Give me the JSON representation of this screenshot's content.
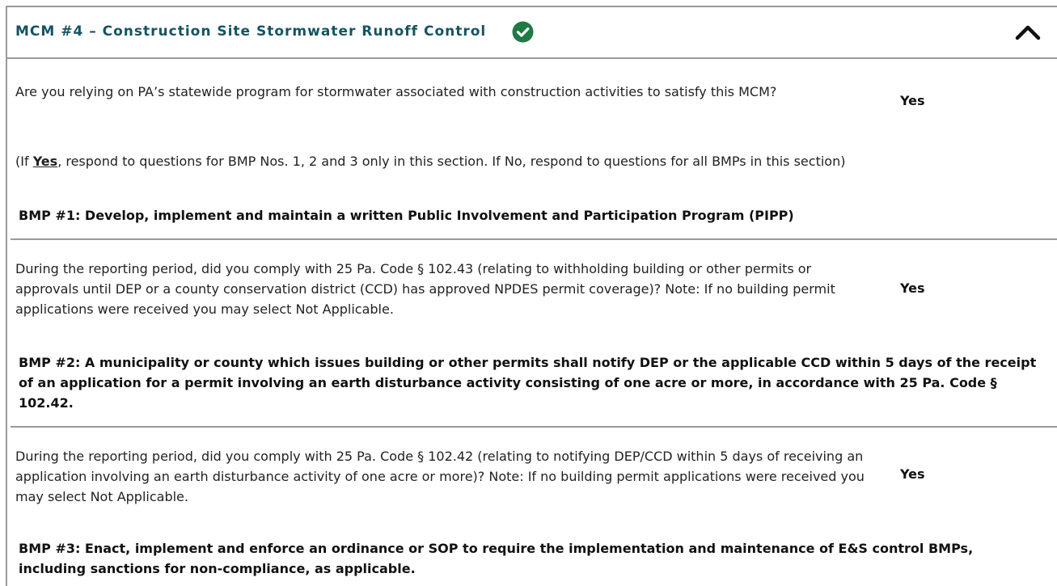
{
  "section": {
    "title": "MCM #4 – Construction Site Stormwater Runoff Control",
    "status": "complete",
    "status_color": "#1f7a45",
    "title_color": "#145461",
    "icons": {
      "status": "check-circle-icon",
      "toggle": "chevron-up-icon"
    }
  },
  "intro_question": {
    "text": "Are you relying on PA’s statewide program for stormwater associated with construction activities to satisfy this MCM?",
    "answer": "Yes"
  },
  "note": {
    "prefix": "(If ",
    "emphasis": "Yes",
    "suffix": ", respond to questions for BMP Nos. 1, 2 and 3 only in this section. If No, respond to questions for all BMPs in this section)"
  },
  "bmps": [
    {
      "title": "BMP #1: Develop, implement and maintain a written Public Involvement and Participation Program (PIPP)",
      "question": "During the reporting period, did you comply with 25 Pa. Code § 102.43 (relating to withholding building or other permits or approvals until DEP or a county conservation district (CCD) has approved NPDES permit coverage)? Note: If no building permit applications were received you may select Not Applicable.",
      "answer": "Yes"
    },
    {
      "title": "BMP #2: A municipality or county which issues building or other permits shall notify DEP or the applicable CCD within 5 days of the receipt of an application for a permit involving an earth disturbance activity consisting of one acre or more, in accordance with 25 Pa. Code § 102.42.",
      "question": "During the reporting period, did you comply with 25 Pa. Code § 102.42 (relating to notifying DEP/CCD within 5 days of receiving an application involving an earth disturbance activity of one acre or more)? Note: If no building permit applications were received you may select Not Applicable.",
      "answer": "Yes"
    },
    {
      "title": "BMP #3: Enact, implement and enforce an ordinance or SOP to require the implementation and maintenance of E&S control BMPs, including sanctions for non-compliance, as applicable."
    }
  ]
}
